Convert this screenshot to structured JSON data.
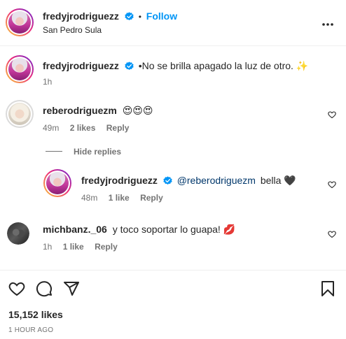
{
  "post": {
    "author": "fredyjrodriguezz",
    "follow_label": "Follow",
    "location": "San Pedro Sula",
    "separator": "•",
    "caption": "•No se brilla apagado la luz de otro. ✨",
    "caption_time": "1h"
  },
  "comments": [
    {
      "username": "reberodriguezm",
      "text": "😍😍😍",
      "time": "49m",
      "likes": "2 likes",
      "reply_label": "Reply",
      "hide_replies_label": "Hide replies",
      "replies": [
        {
          "username": "fredyjrodriguezz",
          "mention": "@reberodriguezm",
          "text": "bella 🖤",
          "time": "48m",
          "likes": "1 like",
          "reply_label": "Reply"
        }
      ]
    },
    {
      "username": "michbanz._06",
      "text": "y toco soportar lo guapa! 💋",
      "time": "1h",
      "likes": "1 like",
      "reply_label": "Reply"
    }
  ],
  "footer": {
    "likes_count": "15,152 likes",
    "timestamp": "1 HOUR AGO"
  },
  "icons": {
    "verified": "verified-badge-icon",
    "more": "more-options-icon",
    "like": "heart-icon",
    "comment": "comment-icon",
    "share": "share-icon",
    "save": "bookmark-icon"
  },
  "colors": {
    "accent": "#0095f6",
    "text": "#262626",
    "muted": "#737373"
  }
}
